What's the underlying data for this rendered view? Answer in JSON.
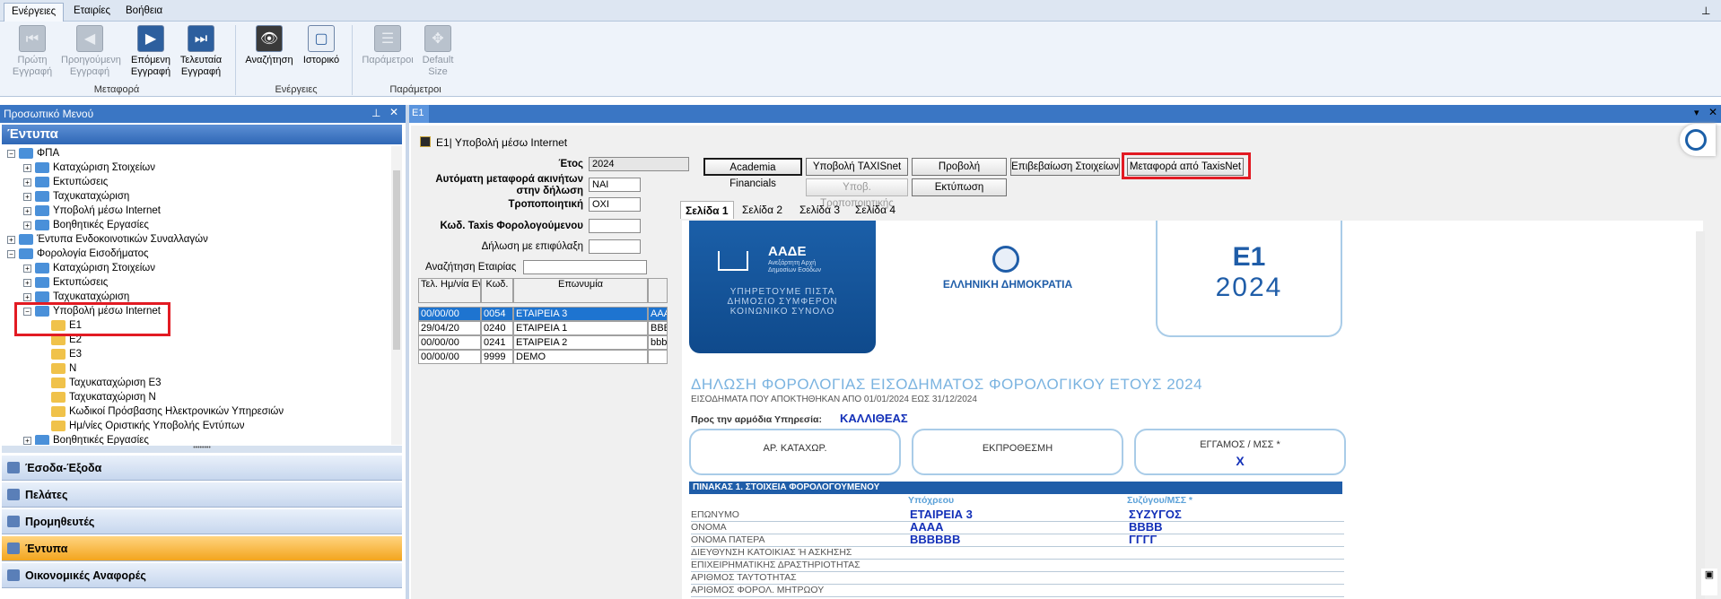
{
  "menu": {
    "tabs": [
      "Ενέργειες",
      "Εταιρίες",
      "Βοήθεια"
    ],
    "pin_icon": "pin-icon"
  },
  "ribbon": {
    "groups": [
      {
        "label": "Μεταφορά",
        "buttons": [
          {
            "line1": "Πρώτη",
            "line2": "Εγγραφή",
            "icon": "first-record-icon",
            "enabled": false
          },
          {
            "line1": "Προηγούμενη",
            "line2": "Εγγραφή",
            "icon": "previous-record-icon",
            "enabled": false
          },
          {
            "line1": "Επόμενη",
            "line2": "Εγγραφή",
            "icon": "next-record-icon",
            "enabled": true
          },
          {
            "line1": "Τελευταία",
            "line2": "Εγγραφή",
            "icon": "last-record-icon",
            "enabled": true
          }
        ]
      },
      {
        "label": "Ενέργειες",
        "buttons": [
          {
            "line1": "Αναζήτηση",
            "line2": "",
            "icon": "binoculars-icon",
            "enabled": true
          },
          {
            "line1": "Ιστορικό",
            "line2": "",
            "icon": "history-icon",
            "enabled": true
          }
        ]
      },
      {
        "label": "Παράμετροι",
        "buttons": [
          {
            "line1": "Παράμετροι",
            "line2": "",
            "icon": "parameters-icon",
            "enabled": false
          },
          {
            "line1": "Default",
            "line2": "Size",
            "icon": "default-size-icon",
            "enabled": false
          }
        ]
      }
    ]
  },
  "left_panel": {
    "title": "Προσωπικό Μενού",
    "section": "Έντυπα",
    "tree": [
      {
        "label": "ΦΠΑ",
        "level": 0,
        "expander": "−",
        "folder": "blue"
      },
      {
        "label": "Καταχώριση Στοιχείων",
        "level": 1,
        "expander": "+",
        "folder": "blue"
      },
      {
        "label": "Εκτυπώσεις",
        "level": 1,
        "expander": "+",
        "folder": "blue"
      },
      {
        "label": "Ταχυκαταχώριση",
        "level": 1,
        "expander": "+",
        "folder": "blue"
      },
      {
        "label": "Υποβολή μέσω Internet",
        "level": 1,
        "expander": "+",
        "folder": "blue"
      },
      {
        "label": "Βοηθητικές Εργασίες",
        "level": 1,
        "expander": "+",
        "folder": "blue"
      },
      {
        "label": "Έντυπα Ενδοκοινοτικών Συναλλαγών",
        "level": 0,
        "expander": "+",
        "folder": "blue"
      },
      {
        "label": "Φορολογία Εισοδήματος",
        "level": 0,
        "expander": "−",
        "folder": "blue"
      },
      {
        "label": "Καταχώριση Στοιχείων",
        "level": 1,
        "expander": "+",
        "folder": "blue"
      },
      {
        "label": "Εκτυπώσεις",
        "level": 1,
        "expander": "+",
        "folder": "blue"
      },
      {
        "label": "Ταχυκαταχώριση",
        "level": 1,
        "expander": "+",
        "folder": "blue"
      },
      {
        "label": "Υποβολή μέσω Internet",
        "level": 1,
        "expander": "−",
        "folder": "blue"
      },
      {
        "label": "E1",
        "level": 2,
        "expander": "",
        "folder": "yellow"
      },
      {
        "label": "E2",
        "level": 2,
        "expander": "",
        "folder": "yellow"
      },
      {
        "label": "E3",
        "level": 2,
        "expander": "",
        "folder": "yellow"
      },
      {
        "label": "N",
        "level": 2,
        "expander": "",
        "folder": "yellow"
      },
      {
        "label": "Ταχυκαταχώριση E3",
        "level": 2,
        "expander": "",
        "folder": "yellow"
      },
      {
        "label": "Ταχυκαταχώριση N",
        "level": 2,
        "expander": "",
        "folder": "yellow"
      },
      {
        "label": "Κωδικοί Πρόσβασης Ηλεκτρονικών Υπηρεσιών",
        "level": 2,
        "expander": "",
        "folder": "yellow"
      },
      {
        "label": "Ημ/νίες Οριστικής Υποβολής Εντύπων",
        "level": 2,
        "expander": "",
        "folder": "yellow"
      },
      {
        "label": "Βοηθητικές Εργασίες",
        "level": 1,
        "expander": "+",
        "folder": "blue"
      }
    ],
    "nav": [
      {
        "label": "Έσοδα-Έξοδα",
        "icon": "income-expense-icon",
        "active": false
      },
      {
        "label": "Πελάτες",
        "icon": "customers-icon",
        "active": false
      },
      {
        "label": "Προμηθευτές",
        "icon": "suppliers-icon",
        "active": false
      },
      {
        "label": "Έντυπα",
        "icon": "forms-icon",
        "active": true
      },
      {
        "label": "Οικονομικές Αναφορές",
        "icon": "reports-icon",
        "active": false
      }
    ]
  },
  "document": {
    "tab": "E1",
    "window_title": "Ε1| Υποβολή μέσω Internet",
    "fields": {
      "year_label": "Έτος",
      "year_value": "2024",
      "auto_transfer_label_1": "Αυτόματη μεταφορά ακινήτων",
      "auto_transfer_label_2": "στην δήλωση",
      "auto_transfer_value": "ΝΑΙ",
      "amending_label": "Τροποποιητική",
      "amending_value": "ΟΧΙ",
      "taxis_code_label": "Κωδ. Taxis Φορολογούμενου",
      "taxis_code_value": "",
      "reserved_label": "Δήλωση με επιφύλαξη",
      "reserved_value": "",
      "search_label": "Αναζήτηση Εταιρίας",
      "search_value": ""
    },
    "buttons": {
      "academia": "Academia Financials",
      "submit_taxisnet": "Υποβολή TAXISnet",
      "preview": "Προβολή",
      "verify": "Επιβεβαίωση Στοιχείων",
      "transfer_taxisnet": "Μεταφορά από TaxisNet",
      "submit_amending": "Υποβ. Τροποποιητικής",
      "print": "Εκτύπωση"
    },
    "page_tabs": [
      "Σελίδα 1",
      "Σελίδα 2",
      "Σελίδα 3",
      "Σελίδα 4"
    ],
    "grid": {
      "headers": [
        "Τελ. Ημ/νία Ενημέρωσης",
        "Κωδ.",
        "Επωνυμία",
        ""
      ],
      "rows": [
        [
          "00/00/00",
          "0054",
          "ΕΤΑΙΡΕΙΑ 3",
          "ΑΑΑ"
        ],
        [
          "29/04/20",
          "0240",
          "ΕΤΑΙΡΕΙΑ 1",
          "ΒΒΒΒ"
        ],
        [
          "00/00/00",
          "0241",
          "ΕΤΑΙΡΕΙΑ 2",
          "bbbb"
        ],
        [
          "00/00/00",
          "9999",
          "DEMO",
          ""
        ]
      ]
    }
  },
  "form": {
    "aade_name": "ΑΑΔΕ",
    "aade_sub1": "Ανεξάρτητη Αρχή",
    "aade_sub2": "Δημοσίων Εσόδων",
    "aade_motto1": "ΥΠΗΡΕΤΟΥΜΕ ΠΙΣΤΑ",
    "aade_motto2": "ΔΗΜΟΣΙΟ ΣΥΜΦΕΡΟΝ",
    "aade_motto3": "ΚΟΙΝΩΝΙΚΟ ΣΥΝΟΛΟ",
    "republic": "ΕΛΛΗΝΙΚΗ ΔΗΜΟΚΡΑΤΙΑ",
    "form_code": "Ε1",
    "form_year": "2024",
    "title": "ΔΗΛΩΣΗ ΦΟΡΟΛΟΓΙΑΣ ΕΙΣΟΔΗΜΑΤΟΣ ΦΟΡΟΛΟΓΙΚΟΥ ΕΤΟΥΣ 2024",
    "subtitle": "ΕΙΣΟΔΗΜΑΤΑ ΠΟΥ ΑΠΟΚΤΗΘΗΚΑΝ ΑΠΟ 01/01/2024 ΕΩΣ 31/12/2024",
    "office_label": "Προς την αρμόδια Υπηρεσία:",
    "office_value": "ΚΑΛΛΙΘΕΑΣ",
    "box1": "ΑΡ. ΚΑΤΑΧΩΡ.",
    "box2": "ΕΚΠΡΟΘΕΣΜΗ",
    "box3": "ΕΓΓΑΜΟΣ / ΜΣΣ *",
    "box3_value": "Χ",
    "table_title": "ΠΙΝΑΚΑΣ 1. ΣΤΟΙΧΕΙΑ ΦΟΡΟΛΟΓΟΥΜΕΝΟΥ",
    "col1": "Υπόχρεου",
    "col2": "Συζύγου/ΜΣΣ *",
    "rows": [
      {
        "label": "ΕΠΩΝΥΜΟ",
        "v1": "ΕΤΑΙΡΕΙΑ 3",
        "v2": "ΣΥΖΥΓΟΣ"
      },
      {
        "label": "ΟΝΟΜΑ",
        "v1": "ΑΑΑΑ",
        "v2": "ΒΒΒΒ"
      },
      {
        "label": "ΟΝΟΜΑ ΠΑΤΕΡΑ",
        "v1": "ΒΒΒΒΒΒ",
        "v2": "ΓΓΓΓ"
      },
      {
        "label": "ΔΙΕΥΘΥΝΣΗ ΚΑΤΟΙΚΙΑΣ Ή ΑΣΚΗΣΗΣ",
        "v1": "",
        "v2": ""
      },
      {
        "label": "ΕΠΙΧΕΙΡΗΜΑΤΙΚΗΣ ΔΡΑΣΤΗΡΙΟΤΗΤΑΣ",
        "v1": "",
        "v2": ""
      },
      {
        "label": "ΑΡΙΘΜΟΣ ΤΑΥΤΟΤΗΤΑΣ",
        "v1": "",
        "v2": ""
      },
      {
        "label": "ΑΡΙΘΜΟΣ ΦΟΡΟΛ. ΜΗΤΡΩΟΥ",
        "v1": "",
        "v2": ""
      }
    ]
  },
  "colors": {
    "accent": "#3a76c4",
    "highlight": "#e21b23",
    "form_blue": "#1330b8",
    "active_nav": "#f3a51e"
  }
}
